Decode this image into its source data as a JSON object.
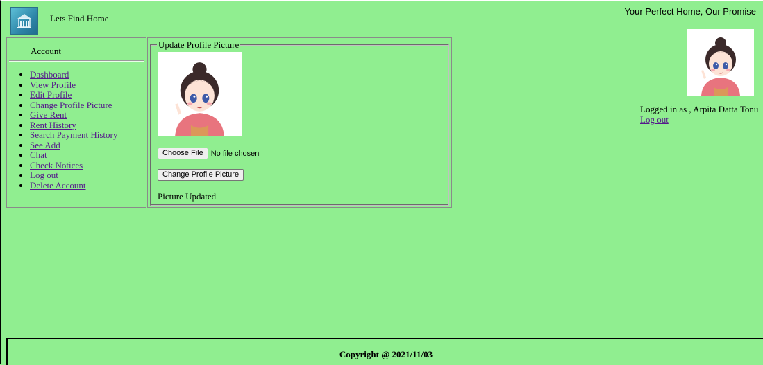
{
  "header": {
    "site_title": "Lets Find Home",
    "tagline": "Your Perfect Home, Our Promise",
    "logo_icon": "house-logo-icon"
  },
  "user": {
    "logged_in_text": "Logged in as , Arpita Datta Tonu",
    "logout_label": "Log out",
    "avatar_icon": "avatar-girl-illustration"
  },
  "sidebar": {
    "title": "Account",
    "items": [
      {
        "label": "Dashboard"
      },
      {
        "label": "View Profile"
      },
      {
        "label": "Edit Profile"
      },
      {
        "label": "Change Profile Picture"
      },
      {
        "label": "Give Rent"
      },
      {
        "label": "Rent History"
      },
      {
        "label": "Search Payment History"
      },
      {
        "label": "See Add"
      },
      {
        "label": "Chat"
      },
      {
        "label": "Check Notices"
      },
      {
        "label": "Log out"
      },
      {
        "label": "Delete Account"
      }
    ]
  },
  "main": {
    "legend": "Update Profile Picture",
    "choose_file_label": "Choose File",
    "file_status": "No file chosen",
    "submit_label": "Change Profile Picture",
    "status_message": "Picture Updated"
  },
  "footer": {
    "copyright": "Copyright @ 2021/11/03"
  },
  "colors": {
    "background": "#90ee90",
    "link": "#551a8b"
  }
}
